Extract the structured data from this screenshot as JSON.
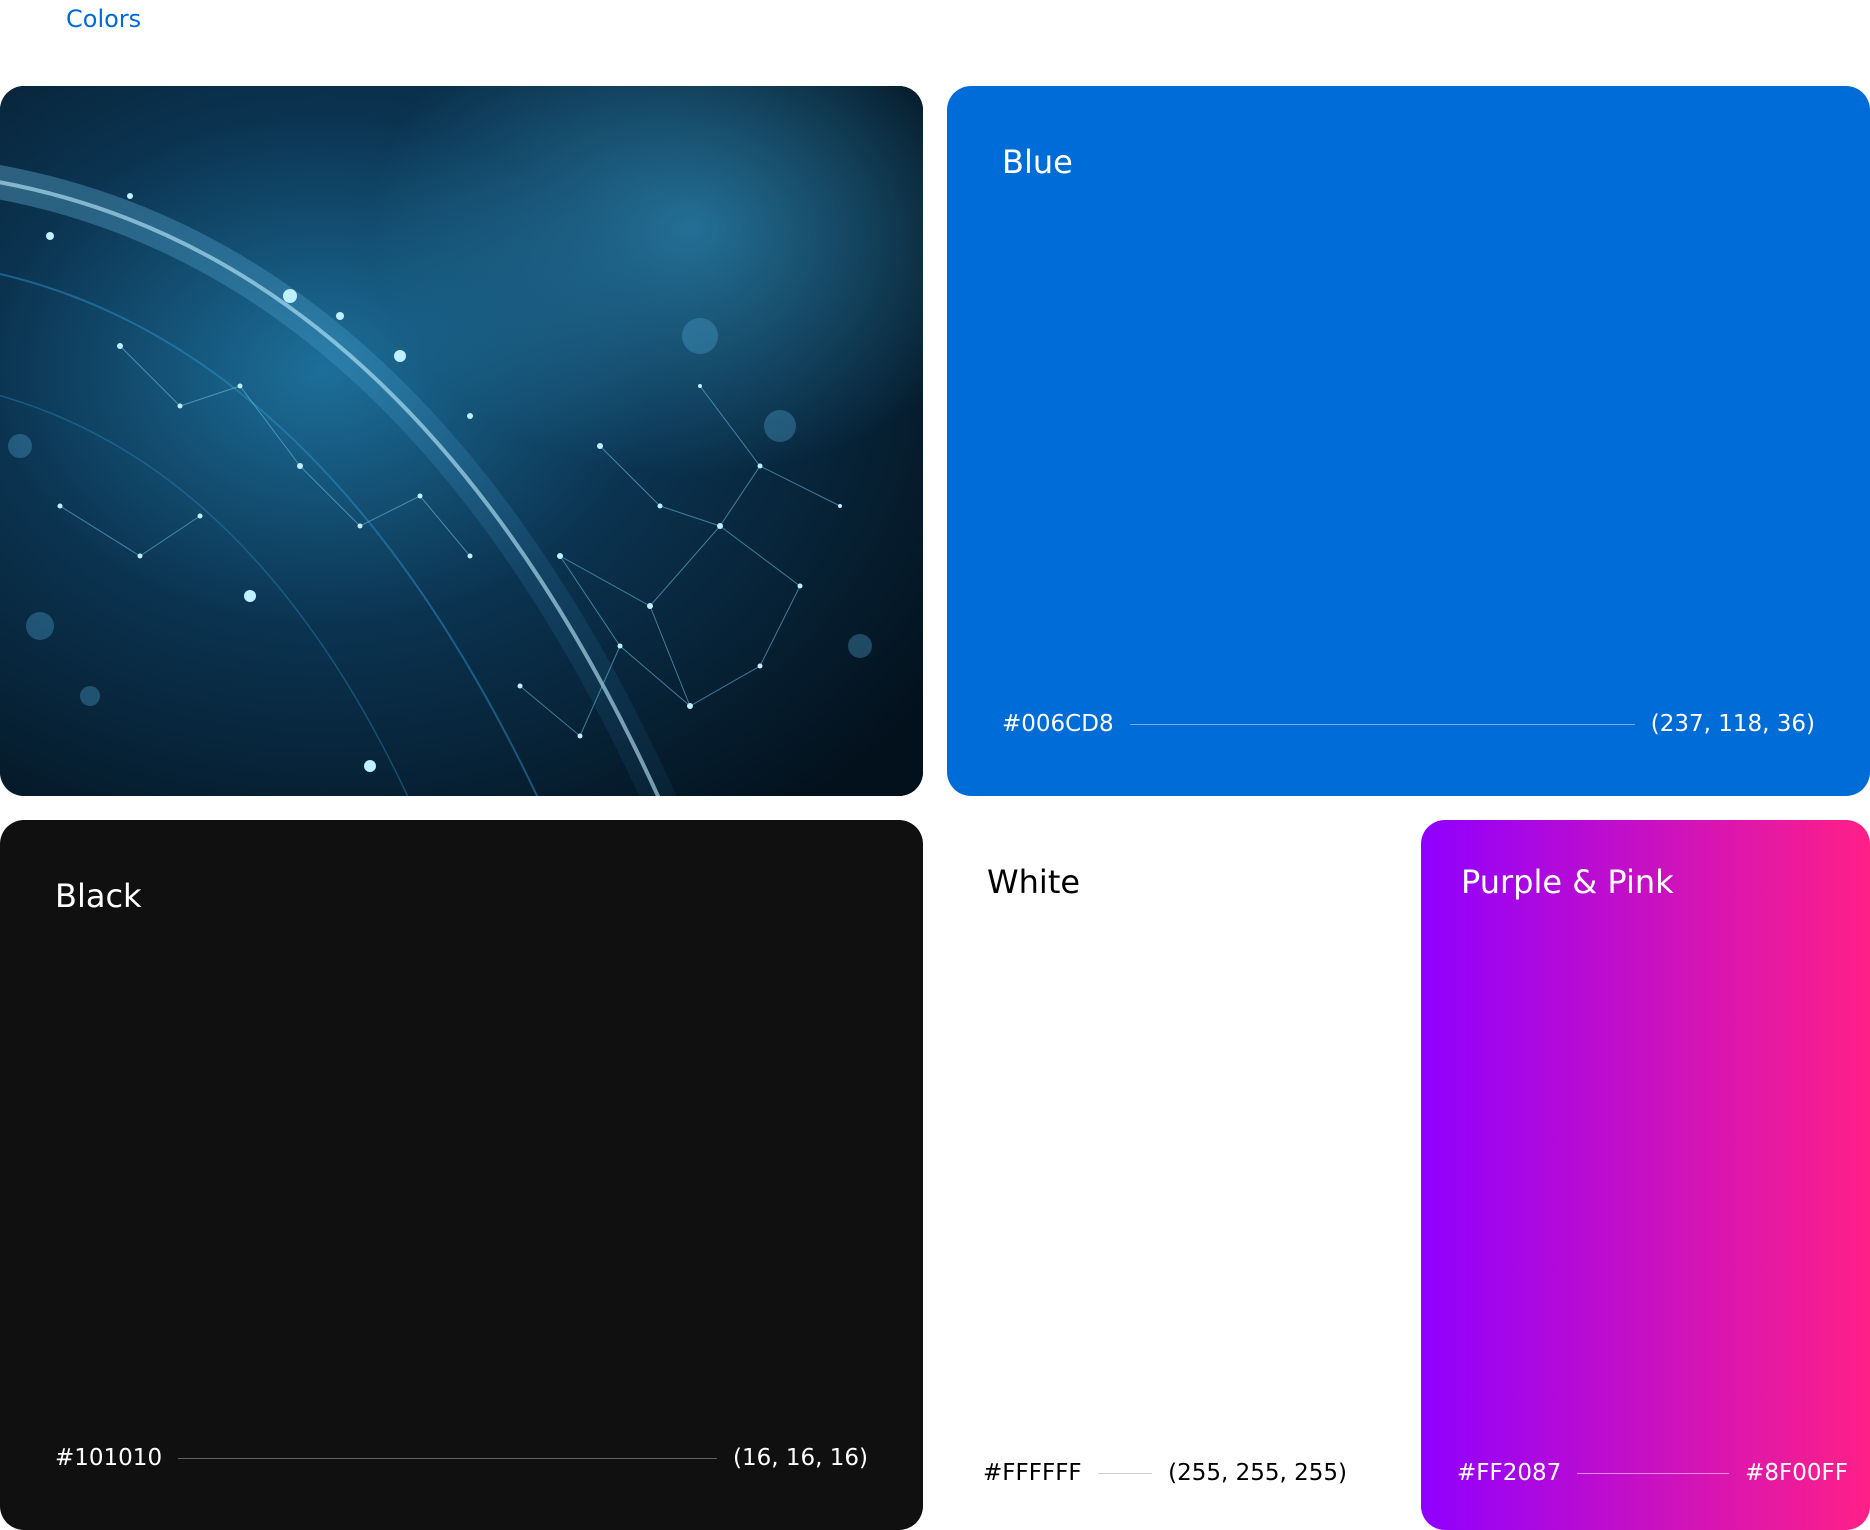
{
  "section": {
    "title": "Colors"
  },
  "cards": {
    "image": {
      "icon": "network-globe-image"
    },
    "blue": {
      "name": "Blue",
      "hex": "#006CD8",
      "rgb": "(237, 118, 36)",
      "color": "#006CD8"
    },
    "black": {
      "name": "Black",
      "hex": "#101010",
      "rgb": "(16, 16, 16)",
      "color": "#101010"
    },
    "white": {
      "name": "White",
      "hex": "#FFFFFF",
      "rgb": "(255, 255, 255)",
      "color": "#FFFFFF"
    },
    "gradient": {
      "name": "Purple & Pink",
      "start": "#FF2087",
      "end": "#8F00FF",
      "colors": [
        "#8F00FF",
        "#FF2087"
      ]
    }
  }
}
